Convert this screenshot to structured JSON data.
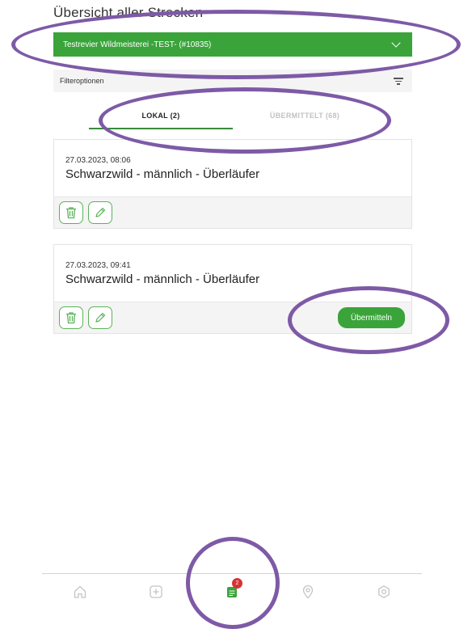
{
  "page": {
    "title": "Übersicht aller Strecken"
  },
  "revier": {
    "selected": "Testrevier Wildmeisterei -TEST- (#10835)",
    "icon": "chevron-down-icon"
  },
  "filter": {
    "label": "Filteroptionen",
    "icon": "filter-icon"
  },
  "tabs": [
    {
      "label": "LOKAL (2)",
      "active": true
    },
    {
      "label": "ÜBERMITTELT (68)",
      "active": false
    }
  ],
  "entries": [
    {
      "date": "27.03.2023, 08:06",
      "title": "Schwarzwild - männlich - Überläufer",
      "submit_label": ""
    },
    {
      "date": "27.03.2023, 09:41",
      "title": "Schwarzwild - männlich - Überläufer",
      "submit_label": "Übermitteln"
    }
  ],
  "nav": {
    "items": [
      {
        "icon": "home-icon"
      },
      {
        "icon": "add-icon"
      },
      {
        "icon": "list-icon",
        "badge": "2",
        "active": true
      },
      {
        "icon": "map-pin-icon"
      },
      {
        "icon": "settings-icon"
      }
    ]
  },
  "colors": {
    "accent": "#3aa43a",
    "badge": "#d53434",
    "annotation": "#7d5aa6",
    "inactive_icon": "#c4c4c4"
  }
}
